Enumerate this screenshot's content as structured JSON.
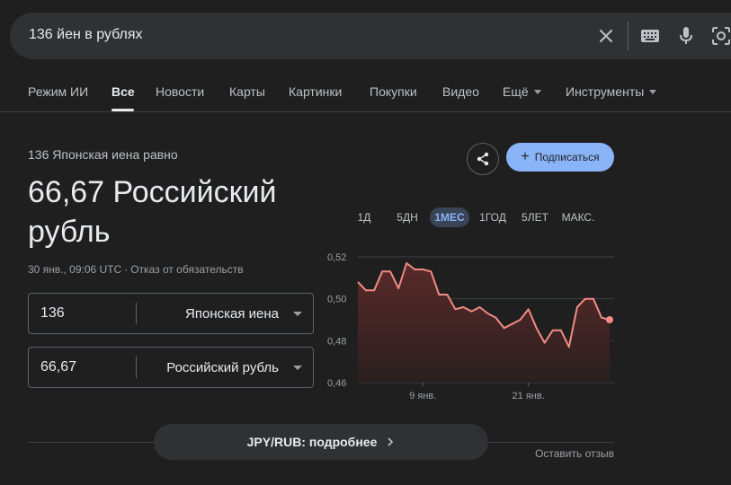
{
  "search": {
    "query": "136 йен в рублях",
    "icons": [
      "close-icon",
      "keyboard-icon",
      "mic-icon",
      "lens-icon"
    ]
  },
  "tabs": [
    {
      "label": "Режим ИИ",
      "active": false
    },
    {
      "label": "Все",
      "active": true
    },
    {
      "label": "Новости",
      "active": false
    },
    {
      "label": "Карты",
      "active": false
    },
    {
      "label": "Картинки",
      "active": false
    },
    {
      "label": "Покупки",
      "active": false
    },
    {
      "label": "Видео",
      "active": false
    },
    {
      "label": "Ещё",
      "active": false
    },
    {
      "label": "Инструменты",
      "active": false
    }
  ],
  "converter": {
    "equal_label": "136 Японская иена равно",
    "result": "66,67 Российский рубль",
    "timestamp": "30 янв., 09:06 UTC",
    "disclaimer": "Отказ от обязательств",
    "from": {
      "value": "136",
      "unit": "Японская иена"
    },
    "to": {
      "value": "66,67",
      "unit": "Российский рубль"
    }
  },
  "actions": {
    "subscribe_label": "Подписаться"
  },
  "ranges": [
    {
      "label": "1Д",
      "active": false
    },
    {
      "label": "5ДН",
      "active": false
    },
    {
      "label": "1МЕС",
      "active": true
    },
    {
      "label": "1ГОД",
      "active": false
    },
    {
      "label": "5ЛЕТ",
      "active": false
    },
    {
      "label": "МАКС.",
      "active": false
    }
  ],
  "chart_data": {
    "type": "area",
    "title": "",
    "xlabel": "",
    "ylabel": "",
    "ylim": [
      0.46,
      0.52
    ],
    "y_ticks": [
      "0,52",
      "0,50",
      "0,48",
      "0,46"
    ],
    "x_ticks": [
      "9 янв.",
      "21 янв."
    ],
    "grid": true,
    "color": "#f28b82",
    "values": [
      0.508,
      0.504,
      0.504,
      0.513,
      0.513,
      0.505,
      0.517,
      0.514,
      0.514,
      0.513,
      0.502,
      0.502,
      0.495,
      0.496,
      0.494,
      0.496,
      0.493,
      0.491,
      0.486,
      0.488,
      0.49,
      0.495,
      0.486,
      0.479,
      0.485,
      0.485,
      0.477,
      0.496,
      0.5,
      0.5,
      0.491,
      0.49
    ]
  },
  "details": {
    "label": "JPY/RUB: подробнее",
    "feedback": "Оставить отзыв"
  }
}
